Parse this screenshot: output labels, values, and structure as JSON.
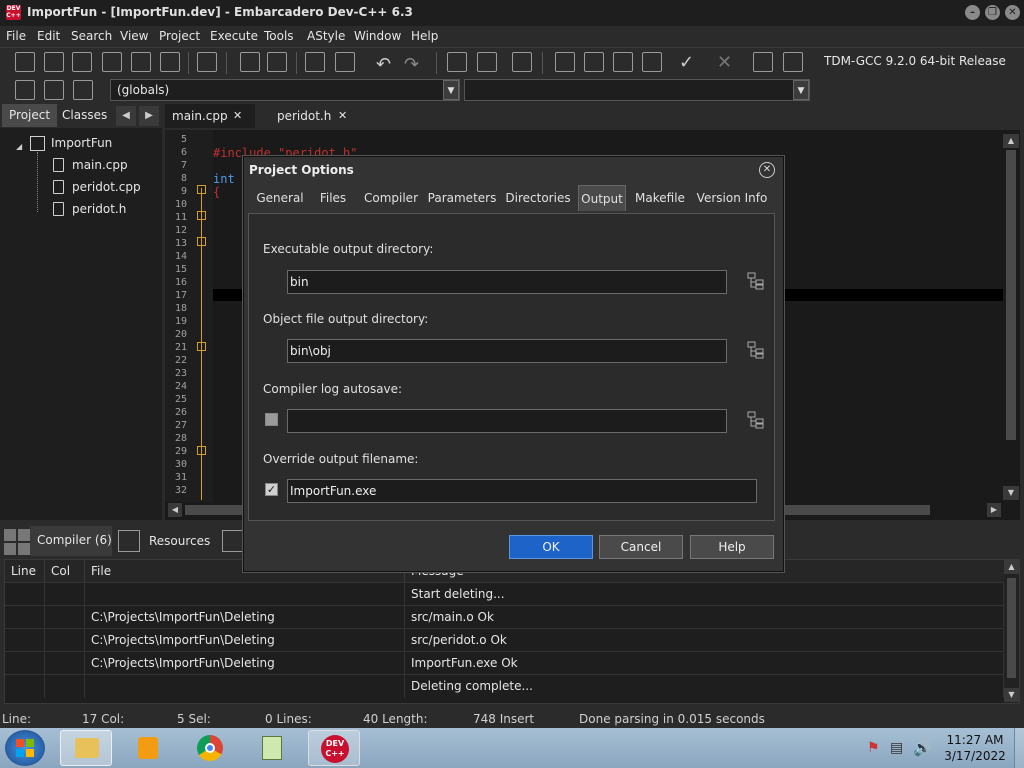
{
  "window": {
    "title": "ImportFun - [ImportFun.dev] - Embarcadero Dev-C++ 6.3"
  },
  "menu": [
    "File",
    "Edit",
    "Search",
    "View",
    "Project",
    "Execute",
    "Tools",
    "AStyle",
    "Window",
    "Help"
  ],
  "compiler_select": "TDM-GCC 9.2.0 64-bit Release",
  "scope_select": "(globals)",
  "left_tabs": [
    "Project",
    "Classes"
  ],
  "project_tree": {
    "root": "ImportFun",
    "files": [
      "main.cpp",
      "peridot.cpp",
      "peridot.h"
    ]
  },
  "editor": {
    "tabs": [
      "main.cpp",
      "peridot.h"
    ],
    "line_numbers": [
      "5",
      "6",
      "7",
      "8",
      "9",
      "10",
      "11",
      "12",
      "13",
      "14",
      "15",
      "16",
      "17",
      "18",
      "19",
      "20",
      "21",
      "22",
      "23",
      "24",
      "25",
      "26",
      "27",
      "28",
      "29",
      "30",
      "31",
      "32"
    ],
    "code_include": "#include \"peridot.h\"",
    "code_int": "int",
    "code_brace": "{"
  },
  "bottom_tabs": [
    "Compiler (6)",
    "Resources"
  ],
  "messages": {
    "headers": [
      "Line",
      "Col",
      "File",
      "Message"
    ],
    "rows": [
      {
        "line": "",
        "col": "",
        "file": "",
        "message": "Start deleting..."
      },
      {
        "line": "",
        "col": "",
        "file": "C:\\Projects\\ImportFun\\Deleting",
        "message": "src/main.o Ok"
      },
      {
        "line": "",
        "col": "",
        "file": "C:\\Projects\\ImportFun\\Deleting",
        "message": "src/peridot.o Ok"
      },
      {
        "line": "",
        "col": "",
        "file": "C:\\Projects\\ImportFun\\Deleting",
        "message": "ImportFun.exe Ok"
      },
      {
        "line": "",
        "col": "",
        "file": "",
        "message": "Deleting complete..."
      }
    ]
  },
  "status": {
    "line": "Line:",
    "col": "17 Col:",
    "sel": "5 Sel:",
    "lines": "0 Lines:",
    "length": "40 Length:",
    "insert": "748 Insert",
    "message": "Done parsing in 0.015 seconds"
  },
  "dialog": {
    "title": "Project Options",
    "tabs": [
      "General",
      "Files",
      "Compiler",
      "Parameters",
      "Directories",
      "Output",
      "Makefile",
      "Version Info"
    ],
    "active_tab": "Output",
    "exe_dir_label": "Executable output directory:",
    "exe_dir_value": "bin",
    "obj_dir_label": "Object file output directory:",
    "obj_dir_value": "bin\\obj",
    "log_label": "Compiler log autosave:",
    "log_checked": false,
    "log_value": "",
    "override_label": "Override output filename:",
    "override_checked": true,
    "override_value": "ImportFun.exe",
    "ok": "OK",
    "cancel": "Cancel",
    "help": "Help"
  },
  "clock": {
    "time": "11:27 AM",
    "date": "3/17/2022"
  },
  "colors": {
    "accent": "#1e64c8",
    "bg": "#2b2b2b",
    "include": "#c03030",
    "keyword": "#4f9be8",
    "fold": "#d79b2c"
  }
}
